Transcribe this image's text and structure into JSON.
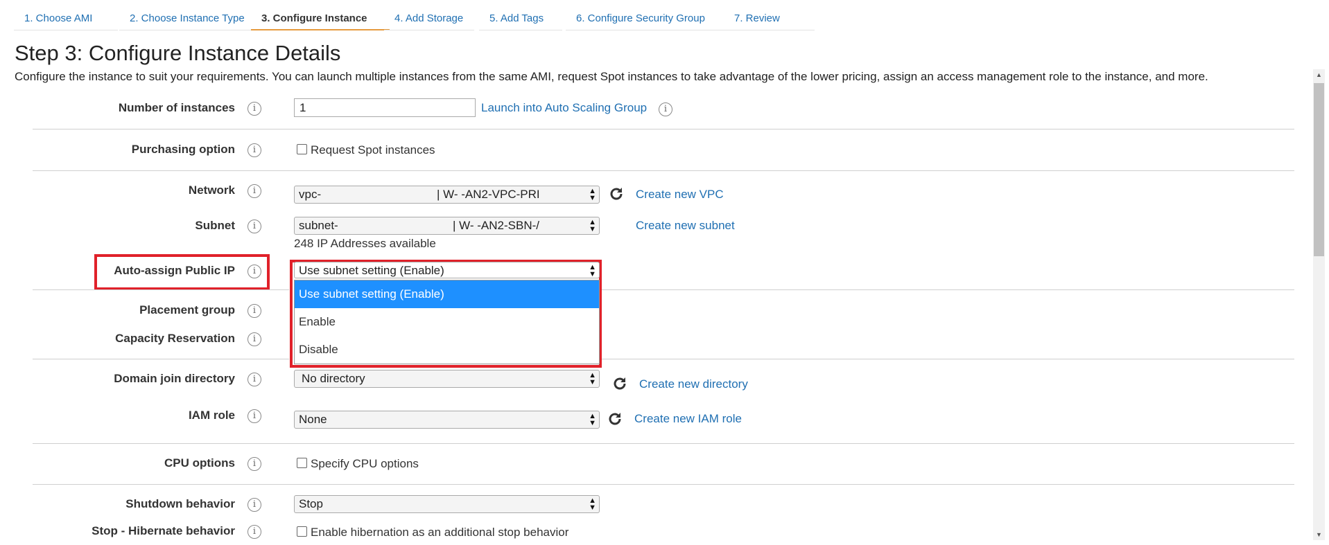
{
  "tabs": [
    {
      "label": "1. Choose AMI"
    },
    {
      "label": "2. Choose Instance Type"
    },
    {
      "label": "3. Configure Instance"
    },
    {
      "label": "4. Add Storage"
    },
    {
      "label": "5. Add Tags"
    },
    {
      "label": "6. Configure Security Group"
    },
    {
      "label": "7. Review"
    }
  ],
  "page": {
    "title": "Step 3: Configure Instance Details",
    "description": "Configure the instance to suit your requirements. You can launch multiple instances from the same AMI, request Spot instances to take advantage of the lower pricing, assign an access management role to the instance, and more."
  },
  "form": {
    "instances": {
      "label": "Number of instances",
      "value": "1",
      "link": "Launch into Auto Scaling Group"
    },
    "purchasing": {
      "label": "Purchasing option",
      "checkbox_label": "Request Spot instances"
    },
    "network": {
      "label": "Network",
      "value_left": "vpc-",
      "value_right": "| W-              -AN2-VPC-PRI",
      "link": "Create new VPC"
    },
    "subnet": {
      "label": "Subnet",
      "value_left": "subnet-",
      "value_right": "| W-              -AN2-SBN-/",
      "note": "248 IP Addresses available",
      "link": "Create new subnet"
    },
    "public_ip": {
      "label": "Auto-assign Public IP",
      "selected": "Use subnet setting (Enable)",
      "options": [
        "Use subnet setting (Enable)",
        "Enable",
        "Disable"
      ]
    },
    "placement": {
      "label": "Placement group"
    },
    "capacity": {
      "label": "Capacity Reservation"
    },
    "domain": {
      "label": "Domain join directory",
      "value": "No directory",
      "link": "Create new directory"
    },
    "iam": {
      "label": "IAM role",
      "value": "None",
      "link": "Create new IAM role"
    },
    "cpu": {
      "label": "CPU options",
      "checkbox_label": "Specify CPU options"
    },
    "shutdown": {
      "label": "Shutdown behavior",
      "value": "Stop"
    },
    "hibernate": {
      "label": "Stop - Hibernate behavior",
      "checkbox_label": "Enable hibernation as an additional stop behavior"
    }
  },
  "colors": {
    "accent_link": "#1f6fb2",
    "highlight": "#e0212a",
    "active_tab_underline": "#e69a3d",
    "dropdown_selected": "#1e90ff"
  }
}
